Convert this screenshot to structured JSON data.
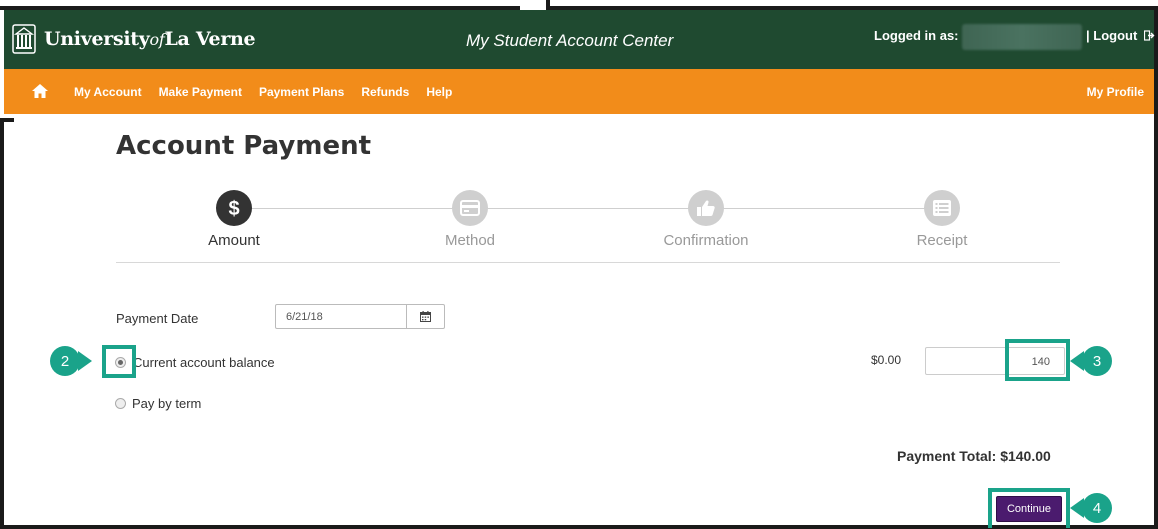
{
  "header": {
    "logo_main": "University",
    "logo_of": "of",
    "logo_end": "La Verne",
    "app_title": "My Student Account Center",
    "logged_in_label": "Logged in as:",
    "logout_label": "| Logout"
  },
  "nav": {
    "items": [
      "My Account",
      "Make Payment",
      "Payment Plans",
      "Refunds",
      "Help"
    ],
    "profile": "My Profile"
  },
  "page": {
    "title": "Account Payment"
  },
  "steps": [
    {
      "label": "Amount",
      "icon": "dollar-icon",
      "active": true
    },
    {
      "label": "Method",
      "icon": "card-icon",
      "active": false
    },
    {
      "label": "Confirmation",
      "icon": "thumbs-up-icon",
      "active": false
    },
    {
      "label": "Receipt",
      "icon": "list-icon",
      "active": false
    }
  ],
  "form": {
    "payment_date_label": "Payment Date",
    "payment_date_value": "6/21/18",
    "option_balance": "Current account balance",
    "option_term": "Pay by term",
    "balance_amount": "$0.00",
    "amount_value": "140",
    "payment_total": "Payment Total: $140.00",
    "continue_label": "Continue"
  },
  "callouts": [
    "2",
    "3",
    "4"
  ],
  "colors": {
    "header_green": "#1f4a30",
    "nav_orange": "#f28c1a",
    "callout_teal": "#1aa38a",
    "button_purple": "#4b1b6e"
  }
}
